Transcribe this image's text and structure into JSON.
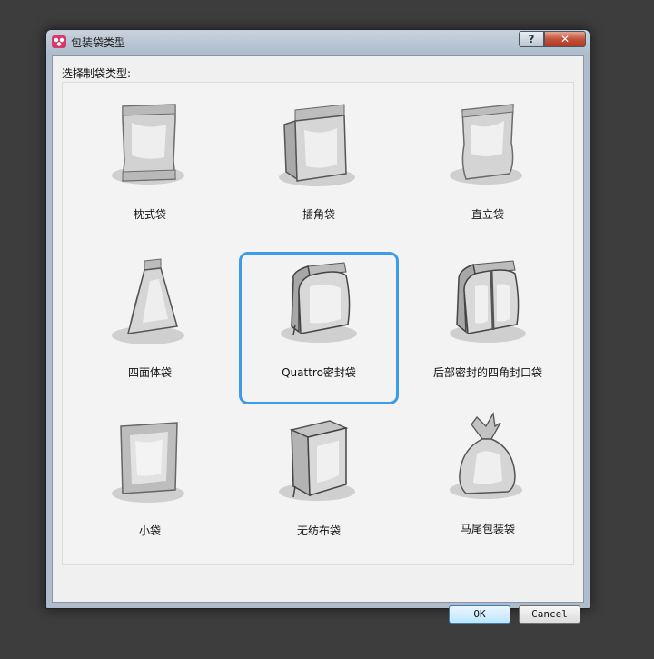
{
  "window": {
    "title": "包装袋类型",
    "help_label": "?",
    "close_label": "✕"
  },
  "prompt": "选择制袋类型:",
  "items": [
    {
      "label": "枕式袋",
      "icon": "pillow-bag-icon"
    },
    {
      "label": "插角袋",
      "icon": "gusset-bag-icon"
    },
    {
      "label": "直立袋",
      "icon": "standup-bag-icon"
    },
    {
      "label": "四面体袋",
      "icon": "tetrahedron-bag-icon"
    },
    {
      "label": "Quattro密封袋",
      "icon": "quattro-bag-icon",
      "selected": true
    },
    {
      "label": "后部密封的四角封口袋",
      "icon": "back-seal-quattro-bag-icon"
    },
    {
      "label": "小袋",
      "icon": "sachet-icon"
    },
    {
      "label": "无纺布袋",
      "icon": "nonwoven-bag-icon"
    },
    {
      "label": "马尾包装袋",
      "icon": "ponytail-bag-icon"
    }
  ],
  "buttons": {
    "ok": "OK",
    "cancel": "Cancel"
  },
  "colors": {
    "selection": "#3e9be6",
    "backdrop": "#3d3d3d"
  }
}
